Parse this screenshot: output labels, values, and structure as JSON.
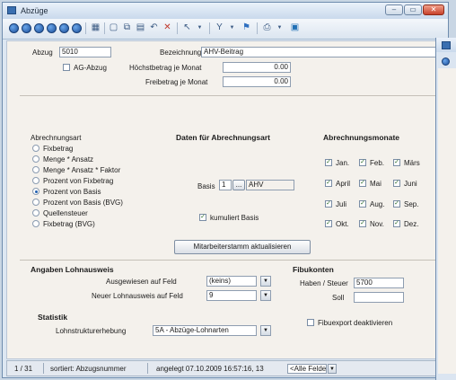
{
  "window": {
    "title": "Abzüge"
  },
  "titlebar_buttons": {
    "min": "–",
    "max": "▭",
    "close": "✕"
  },
  "toolbar": {
    "icons": [
      "first-record-icon",
      "prev-page-icon",
      "prev-record-icon",
      "next-record-icon",
      "next-page-icon",
      "last-record-icon",
      "list-view-icon",
      "new-record-icon",
      "copy-record-icon",
      "save-icon",
      "undo-icon",
      "delete-icon",
      "pointer-icon",
      "dropdown-icon",
      "filter-icon",
      "dropdown-icon",
      "bookmark-icon",
      "print-icon",
      "dropdown-icon",
      "lock-icon"
    ]
  },
  "form": {
    "abzug_label": "Abzug",
    "abzug_value": "5010",
    "bezeichnung_label": "Bezeichnung",
    "bezeichnung_value": "AHV-Beitrag",
    "ag_abzug_label": "AG-Abzug",
    "hoechstbetrag_label": "Höchstbetrag je Monat",
    "hoechstbetrag_value": "0.00",
    "freibetrag_label": "Freibetrag je Monat",
    "freibetrag_value": "0.00",
    "abrechnungsart": {
      "title": "Abrechnungsart",
      "options": [
        "Fixbetrag",
        "Menge * Ansatz",
        "Menge * Ansatz * Faktor",
        "Prozent von Fixbetrag",
        "Prozent von Basis",
        "Prozent von Basis (BVG)",
        "Quellensteuer",
        "Fixbetrag (BVG)"
      ],
      "selected": "Prozent von Basis"
    },
    "daten": {
      "title": "Daten für Abrechnungsart",
      "basis_label": "Basis",
      "basis_value": "1",
      "basis_btn": "...",
      "basis_text": "AHV",
      "kumuliert_label": "kumuliert Basis",
      "button": "Mitarbeiterstamm aktualisieren"
    },
    "monate": {
      "title": "Abrechnungsmonate",
      "items": [
        "Jan.",
        "Feb.",
        "Märs",
        "April",
        "Mai",
        "Juni",
        "Juli",
        "Aug.",
        "Sep.",
        "Okt.",
        "Nov.",
        "Dez."
      ]
    },
    "lohnausweis": {
      "title": "Angaben Lohnausweis",
      "ausgewiesen_label": "Ausgewiesen auf Feld",
      "ausgewiesen_value": "(keins)",
      "neuer_label": "Neuer Lohnausweis auf Feld",
      "neuer_value": "9"
    },
    "statistik": {
      "title": "Statistik",
      "lohnstruktur_label": "Lohnstrukturerhebung",
      "lohnstruktur_value": "5A - Abzüge-Lohnarten"
    },
    "fibukonten": {
      "title": "Fibukonten",
      "haben_label": "Haben / Steuer",
      "haben_value": "5700",
      "soll_label": "Soll",
      "soll_value": "",
      "export_label": "Fibuexport deaktivieren"
    }
  },
  "statusbar": {
    "record": "1 / 31",
    "sort": "sortiert: Abzugsnummer",
    "created": "angelegt 07.10.2009 16:57:16, 13",
    "filter": "<Alle Felder>"
  }
}
